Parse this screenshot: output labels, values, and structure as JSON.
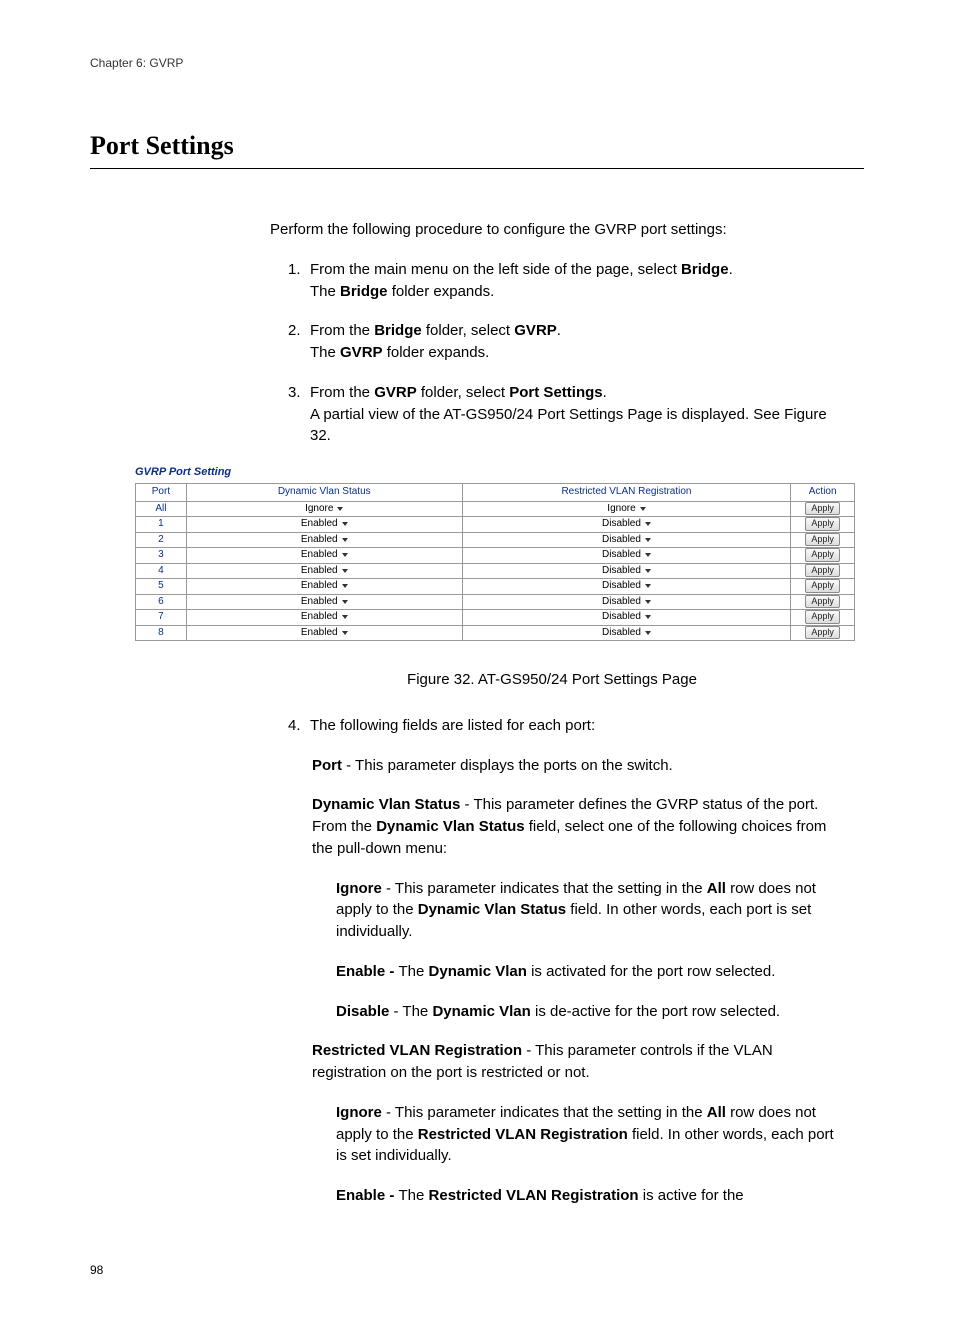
{
  "chapterHeader": "Chapter 6: GVRP",
  "pageTitle": "Port Settings",
  "intro": "Perform the following procedure to configure the GVRP port settings:",
  "steps": {
    "1": {
      "num": "1.",
      "l1a": "From the main menu on the left side of the page, select ",
      "l1b": "Bridge",
      "l1c": ".",
      "l2a": "The ",
      "l2b": "Bridge",
      "l2c": " folder expands."
    },
    "2": {
      "num": "2.",
      "l1a": "From the ",
      "l1b": "Bridge",
      "l1c": " folder, select ",
      "l1d": "GVRP",
      "l1e": ".",
      "l2a": "The ",
      "l2b": "GVRP",
      "l2c": " folder expands."
    },
    "3": {
      "num": "3.",
      "l1a": "From the ",
      "l1b": "GVRP",
      "l1c": " folder, select ",
      "l1d": "Port Settings",
      "l1e": ".",
      "l2": "A partial view of the AT-GS950/24 Port Settings Page is displayed. See Figure 32."
    },
    "4": {
      "num": "4.",
      "text": "The following fields are listed for each port:"
    }
  },
  "figure": {
    "title": "GVRP Port Setting",
    "headers": {
      "port": "Port",
      "dvs": "Dynamic Vlan Status",
      "rvr": "Restricted VLAN Registration",
      "action": "Action"
    },
    "applyLabel": "Apply",
    "rows": [
      {
        "port": "All",
        "dvs": "Ignore",
        "rvr": "Ignore"
      },
      {
        "port": "1",
        "dvs": "Enabled",
        "rvr": "Disabled"
      },
      {
        "port": "2",
        "dvs": "Enabled",
        "rvr": "Disabled"
      },
      {
        "port": "3",
        "dvs": "Enabled",
        "rvr": "Disabled"
      },
      {
        "port": "4",
        "dvs": "Enabled",
        "rvr": "Disabled"
      },
      {
        "port": "5",
        "dvs": "Enabled",
        "rvr": "Disabled"
      },
      {
        "port": "6",
        "dvs": "Enabled",
        "rvr": "Disabled"
      },
      {
        "port": "7",
        "dvs": "Enabled",
        "rvr": "Disabled"
      },
      {
        "port": "8",
        "dvs": "Enabled",
        "rvr": "Disabled"
      }
    ],
    "caption": "Figure 32. AT-GS950/24 Port Settings Page"
  },
  "defs": {
    "port": {
      "label": "Port",
      "text": " - This parameter displays the ports on the switch."
    },
    "dvs": {
      "label": "Dynamic Vlan Status",
      "text1": " - This parameter defines the GVRP status of the port. From the ",
      "bold1": "Dynamic Vlan Status",
      "text2": " field, select one of the following choices from the pull-down menu:"
    },
    "dvsIgnore": {
      "label": "Ignore",
      "t1": " - This parameter indicates that the setting in the ",
      "b1": "All",
      "t2": " row does not apply to the ",
      "b2": "Dynamic Vlan Status",
      "t3": " field. In other words, each port is set individually."
    },
    "dvsEnable": {
      "label": "Enable - ",
      "t1": "The ",
      "b1": "Dynamic Vlan",
      "t2": " is activated for the port row selected."
    },
    "dvsDisable": {
      "label": "Disable",
      "t1": " - The ",
      "b1": "Dynamic Vlan",
      "t2": " is de-active for the port row selected."
    },
    "rvr": {
      "label": "Restricted VLAN Registration",
      "text": " - This parameter controls if the VLAN registration on the port is restricted or not."
    },
    "rvrIgnore": {
      "label": "Ignore",
      "t1": " - This parameter indicates that the setting in the ",
      "b1": "All",
      "t2": " row does not apply to the ",
      "b2": "Restricted VLAN Registration",
      "t3": " field. In other words, each port is set individually."
    },
    "rvrEnable": {
      "label": "Enable - ",
      "t1": "The ",
      "b1": "Restricted VLAN Registration",
      "t2": " is active for the"
    }
  },
  "pageNum": "98"
}
